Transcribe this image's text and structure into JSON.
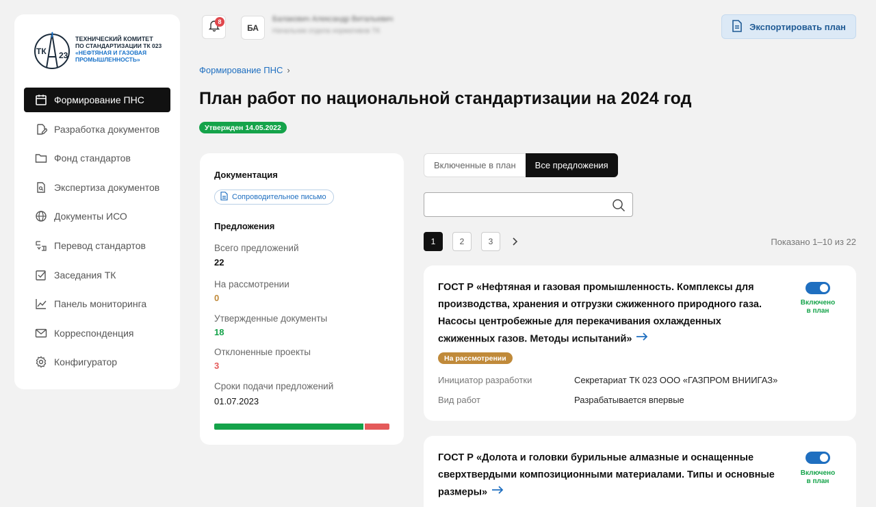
{
  "logo": {
    "mark": "ТК 23",
    "line1": "ТЕХНИЧЕСКИЙ КОМИТЕТ",
    "line2": "ПО СТАНДАРТИЗАЦИИ ТК 023",
    "line3": "«НЕФТЯНАЯ И ГАЗОВАЯ",
    "line4": "ПРОМЫШЛЕННОСТЬ»"
  },
  "sidebar": {
    "items": [
      {
        "label": "Формирование ПНС",
        "icon": "calendar-icon",
        "active": true
      },
      {
        "label": "Разработка документов",
        "icon": "document-edit-icon",
        "active": false
      },
      {
        "label": "Фонд стандартов",
        "icon": "folder-icon",
        "active": false
      },
      {
        "label": "Экспертиза документов",
        "icon": "document-search-icon",
        "active": false
      },
      {
        "label": "Документы ИСО",
        "icon": "globe-icon",
        "active": false
      },
      {
        "label": "Перевод стандартов",
        "icon": "translate-icon",
        "active": false
      },
      {
        "label": "Заседания ТК",
        "icon": "checkbox-icon",
        "active": false
      },
      {
        "label": "Панель мониторинга",
        "icon": "chart-icon",
        "active": false
      },
      {
        "label": "Корреспонденция",
        "icon": "mail-icon",
        "active": false
      },
      {
        "label": "Конфигуратор",
        "icon": "gear-icon",
        "active": false
      }
    ]
  },
  "header": {
    "notifications_count": "8",
    "avatar_initials": "БА",
    "user_name": "Балакович Александр Витальевич",
    "user_role": "Начальник отдела нормативов ТК",
    "export_label": "Экспортировать план"
  },
  "breadcrumb": {
    "item": "Формирование ПНС",
    "separator": "›"
  },
  "page": {
    "title": "План работ по национальной стандартизации на 2024 год",
    "status": "Утвержден 14.05.2022"
  },
  "stats": {
    "docs_heading": "Документация",
    "letter_label": "Сопроводительное письмо",
    "proposals_heading": "Предложения",
    "total_label": "Всего предложений",
    "total_value": "22",
    "review_label": "На рассмотрении",
    "review_value": "0",
    "approved_label": "Утвержденные документы",
    "approved_value": "18",
    "rejected_label": "Отклоненные проекты",
    "rejected_value": "3",
    "deadline_label": "Сроки подачи предложений",
    "deadline_value": "01.07.2023",
    "colors": {
      "approved": "#15a34a",
      "rejected": "#e45a5a",
      "review": "#c08a3a"
    }
  },
  "tabs": [
    {
      "label": "Включенные в план",
      "active": false
    },
    {
      "label": "Все предложения",
      "active": true
    }
  ],
  "search": {
    "value": "",
    "placeholder": ""
  },
  "pagination": {
    "pages": [
      "1",
      "2",
      "3"
    ],
    "current": "1",
    "shown": "Показано 1–10 из 22"
  },
  "cards": [
    {
      "title": "ГОСТ Р «Нефтяная и газовая промышленность. Комплексы для производства, хранения и отгрузки сжиженного природного газа. Насосы центробежные для перекачивания охлажденных сжиженных газов. Методы испытаний»",
      "toggle_label_1": "Включено",
      "toggle_label_2": "в план",
      "status": "На рассмотрении",
      "initiator_label": "Инициатор разработки",
      "initiator_value": "Секретариат ТК 023 ООО «ГАЗПРОМ ВНИИГАЗ»",
      "work_label": "Вид работ",
      "work_value": "Разрабатывается впервые"
    },
    {
      "title": "ГОСТ Р «Долота и головки бурильные алмазные и оснащенные сверхтвердыми композиционными материалами. Типы и основные размеры»",
      "toggle_label_1": "Включено",
      "toggle_label_2": "в план"
    }
  ]
}
